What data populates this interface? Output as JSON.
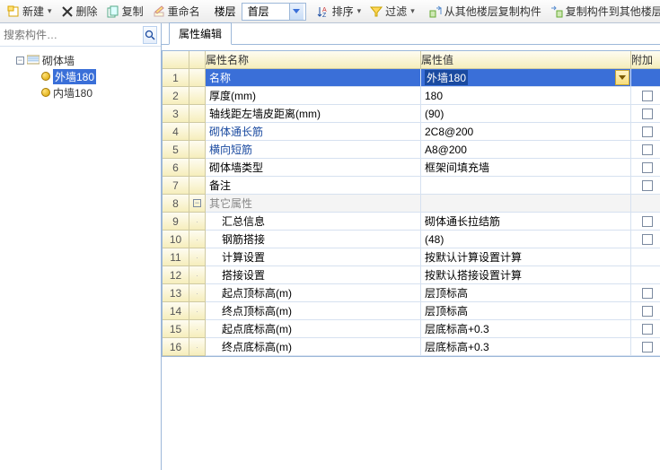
{
  "toolbar": {
    "new": "新建",
    "delete": "删除",
    "copy": "复制",
    "rename": "重命名",
    "floor_label": "楼层",
    "floor_value": "首层",
    "sort": "排序",
    "filter": "过滤",
    "copy_from": "从其他楼层复制构件",
    "copy_to": "复制构件到其他楼层"
  },
  "search": {
    "placeholder": "搜索构件…"
  },
  "tree": {
    "root": "砌体墙",
    "children": [
      "外墙180",
      "内墙180"
    ],
    "selected_index": 0
  },
  "tab": {
    "label": "属性编辑"
  },
  "grid": {
    "headers": {
      "name": "属性名称",
      "value": "属性值",
      "extra": "附加"
    },
    "rows": [
      {
        "n": 1,
        "name": "名称",
        "value": "外墙180",
        "link": false,
        "checkbox": false,
        "selected": true,
        "val_dd": true,
        "val_highlight": true
      },
      {
        "n": 2,
        "name": "厚度(mm)",
        "value": "180",
        "checkbox": true
      },
      {
        "n": 3,
        "name": "轴线距左墙皮距离(mm)",
        "value": "(90)",
        "checkbox": true
      },
      {
        "n": 4,
        "name": "砌体通长筋",
        "value": "2C8@200",
        "link": true,
        "checkbox": true
      },
      {
        "n": 5,
        "name": "横向短筋",
        "value": "A8@200",
        "link": true,
        "checkbox": true
      },
      {
        "n": 6,
        "name": "砌体墙类型",
        "value": "框架间填充墙",
        "checkbox": true
      },
      {
        "n": 7,
        "name": "备注",
        "value": "",
        "checkbox": true
      },
      {
        "n": 8,
        "name": "其它属性",
        "value": "",
        "section": true
      },
      {
        "n": 9,
        "name": "汇总信息",
        "value": "砌体通长拉结筋",
        "indent": true,
        "checkbox": true
      },
      {
        "n": 10,
        "name": "钢筋搭接",
        "value": "(48)",
        "indent": true,
        "checkbox": true
      },
      {
        "n": 11,
        "name": "计算设置",
        "value": "按默认计算设置计算",
        "indent": true
      },
      {
        "n": 12,
        "name": "搭接设置",
        "value": "按默认搭接设置计算",
        "indent": true
      },
      {
        "n": 13,
        "name": "起点顶标高(m)",
        "value": "层顶标高",
        "indent": true,
        "checkbox": true
      },
      {
        "n": 14,
        "name": "终点顶标高(m)",
        "value": "层顶标高",
        "indent": true,
        "checkbox": true
      },
      {
        "n": 15,
        "name": "起点底标高(m)",
        "value": "层底标高+0.3",
        "indent": true,
        "checkbox": true
      },
      {
        "n": 16,
        "name": "终点底标高(m)",
        "value": "层底标高+0.3",
        "indent": true,
        "checkbox": true
      }
    ]
  }
}
